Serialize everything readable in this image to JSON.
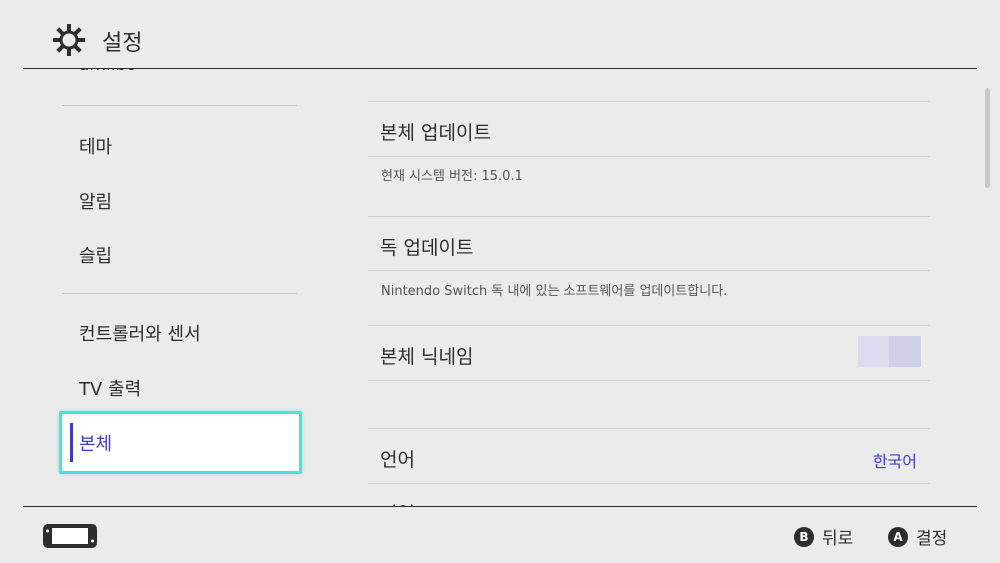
{
  "header": {
    "title": "설정",
    "icon": "gear-icon"
  },
  "sidebar": {
    "partial_item": "amiibo",
    "items": [
      {
        "label": "테마"
      },
      {
        "label": "알림"
      },
      {
        "label": "슬립"
      },
      {
        "label": "컨트롤러와 센서"
      },
      {
        "label": "TV 출력"
      },
      {
        "label": "본체"
      }
    ],
    "selected_index": 5
  },
  "content": {
    "system_update": {
      "title": "본체 업데이트",
      "subtitle": "현재 시스템 버전: 15.0.1"
    },
    "dock_update": {
      "title": "독 업데이트",
      "subtitle": "Nintendo Switch 독 내에 있는 소프트웨어를 업데이트합니다."
    },
    "console_nickname": {
      "title": "본체 닉네임"
    },
    "language": {
      "title": "언어",
      "value": "한국어"
    },
    "partial_bottom": "지역"
  },
  "footer": {
    "back": {
      "button": "B",
      "label": "뒤로"
    },
    "ok": {
      "button": "A",
      "label": "결정"
    }
  },
  "colors": {
    "accent": "#3d3dc8",
    "selection_border": "#47e6d4",
    "background": "#ebebeb"
  }
}
